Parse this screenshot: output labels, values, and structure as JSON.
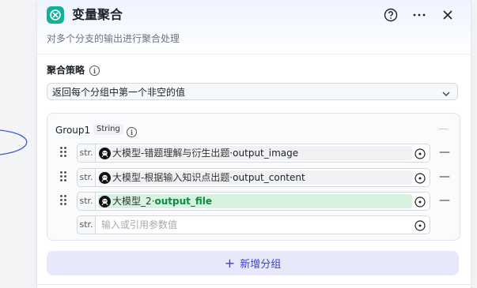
{
  "node": {
    "title": "变量聚合",
    "description": "对多个分支的输出进行聚合处理",
    "accent": "#10b39a"
  },
  "header_actions": {
    "help_icon": "question-circle-icon",
    "more_icon": "ellipsis-icon",
    "close_icon": "close-icon"
  },
  "strategy": {
    "label": "聚合策略",
    "info": "i",
    "selected": "返回每个分组中第一个非空的值"
  },
  "group": {
    "name": "Group1",
    "type": "String",
    "info": "i",
    "dash": "—",
    "rows": [
      {
        "prefix": "str.",
        "source": "大模型-错题理解与衍生出题",
        "sep": " · ",
        "variable": "output_image",
        "highlight": false
      },
      {
        "prefix": "str.",
        "source": "大模型-根据输入知识点出题",
        "sep": " · ",
        "variable": "output_content",
        "highlight": false
      },
      {
        "prefix": "str.",
        "source": "大模型_2",
        "sep": " · ",
        "variable": "output_file",
        "highlight": true
      }
    ],
    "empty_row": {
      "prefix": "str.",
      "placeholder": "输入或引用参数值"
    },
    "remove_label": "—"
  },
  "add_group": {
    "plus": "+",
    "label": "新增分组",
    "color": "#3b3fd1"
  }
}
